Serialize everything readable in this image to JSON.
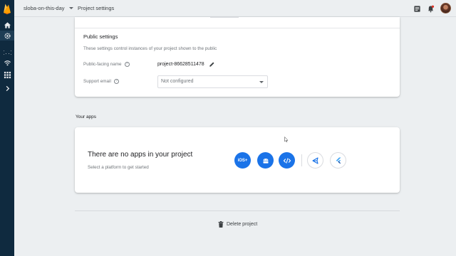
{
  "topbar": {
    "project_name": "sloba-on-this-day",
    "breadcrumb": "Project settings"
  },
  "public_settings": {
    "title": "Public settings",
    "description": "These settings control instances of your project shown to the public",
    "public_name_label": "Public-facing name",
    "public_name_value": "project-86628511478",
    "support_email_label": "Support email",
    "support_email_value": "Not configured"
  },
  "apps": {
    "section_title": "Your apps",
    "empty_title": "There are no apps in your project",
    "empty_subtitle": "Select a platform to get started",
    "platforms": [
      {
        "label": "iOS+",
        "icon": "ios-icon"
      },
      {
        "label": "",
        "icon": "android-icon"
      },
      {
        "label": "",
        "icon": "web-code-icon"
      },
      {
        "label": "",
        "icon": "unity-icon"
      },
      {
        "label": "",
        "icon": "flutter-icon"
      }
    ]
  },
  "delete_label": "Delete project",
  "colors": {
    "rail": "#0f2a3f",
    "accent": "#1a73e8",
    "logo": "#ffa000"
  }
}
